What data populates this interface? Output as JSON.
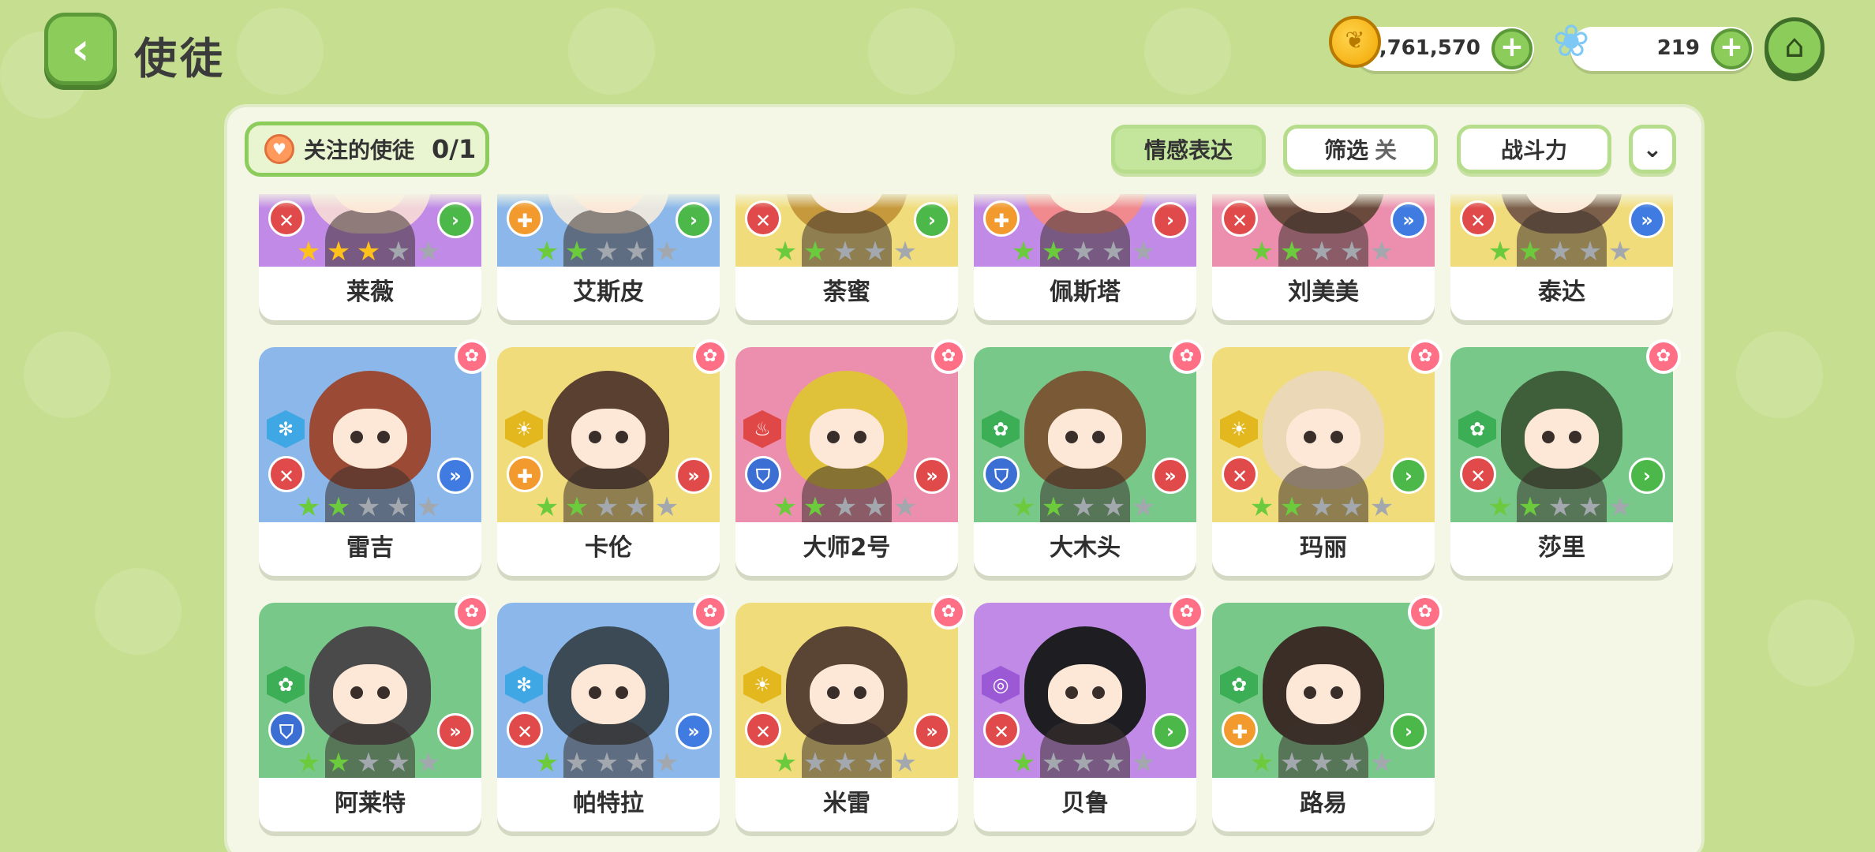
{
  "header": {
    "back_icon": "chevron-left-icon",
    "title": "使徒",
    "coins": "6,761,570",
    "gems": "219",
    "home_icon": "home-icon"
  },
  "toolbar": {
    "follow_label": "关注的使徒",
    "follow_count": "0/1",
    "emotion_label": "情感表达",
    "filter_label": "筛选",
    "filter_state": "关",
    "power_label": "战斗力",
    "collapse_icon": "double-chevron-down-icon"
  },
  "colors": {
    "purple": "#c08ae6",
    "blue": "#8bb7ea",
    "yellow": "#f1dc7b",
    "pink": "#ec8fae",
    "green": "#78c88a"
  },
  "servants": [
    {
      "name": "莱薇",
      "bg": "purple",
      "element": "vortex",
      "role": "attack",
      "arrow": "single",
      "stars": 3,
      "star_color": "gold"
    },
    {
      "name": "艾斯皮",
      "bg": "blue",
      "element": "snow",
      "role": "heal",
      "arrow": "single",
      "stars": 2,
      "star_color": "green"
    },
    {
      "name": "荼蜜",
      "bg": "yellow",
      "element": "sun",
      "role": "attack",
      "arrow": "single",
      "stars": 2,
      "star_color": "green"
    },
    {
      "name": "佩斯塔",
      "bg": "purple",
      "element": "vortex",
      "role": "heal",
      "arrow": "single",
      "stars": 2,
      "star_color": "green"
    },
    {
      "name": "刘美美",
      "bg": "pink",
      "element": "fire",
      "role": "attack",
      "arrow": "double",
      "stars": 2,
      "star_color": "green"
    },
    {
      "name": "泰达",
      "bg": "yellow",
      "element": "sun",
      "role": "attack",
      "arrow": "double",
      "stars": 2,
      "star_color": "green"
    },
    {
      "name": "雷吉",
      "bg": "blue",
      "element": "snow",
      "role": "attack",
      "arrow": "double",
      "stars": 2,
      "star_color": "green"
    },
    {
      "name": "卡伦",
      "bg": "yellow",
      "element": "sun",
      "role": "heal",
      "arrow": "double",
      "stars": 2,
      "star_color": "green"
    },
    {
      "name": "大师2号",
      "bg": "pink",
      "element": "fire",
      "role": "shield",
      "arrow": "double",
      "stars": 2,
      "star_color": "green"
    },
    {
      "name": "大木头",
      "bg": "green",
      "element": "leaf",
      "role": "shield",
      "arrow": "double",
      "stars": 2,
      "star_color": "green"
    },
    {
      "name": "玛丽",
      "bg": "yellow",
      "element": "sun",
      "role": "attack",
      "arrow": "single",
      "stars": 2,
      "star_color": "green"
    },
    {
      "name": "莎里",
      "bg": "green",
      "element": "leaf",
      "role": "attack",
      "arrow": "single",
      "stars": 2,
      "star_color": "green"
    },
    {
      "name": "阿莱特",
      "bg": "green",
      "element": "leaf",
      "role": "shield",
      "arrow": "double",
      "stars": 2,
      "star_color": "green"
    },
    {
      "name": "帕特拉",
      "bg": "blue",
      "element": "snow",
      "role": "attack",
      "arrow": "double",
      "stars": 1,
      "star_color": "green"
    },
    {
      "name": "米雷",
      "bg": "yellow",
      "element": "sun",
      "role": "attack",
      "arrow": "double",
      "stars": 1,
      "star_color": "green"
    },
    {
      "name": "贝鲁",
      "bg": "purple",
      "element": "vortex",
      "role": "attack",
      "arrow": "single",
      "stars": 1,
      "star_color": "green"
    },
    {
      "name": "路易",
      "bg": "green",
      "element": "leaf",
      "role": "heal",
      "arrow": "single",
      "stars": 1,
      "star_color": "green"
    }
  ]
}
